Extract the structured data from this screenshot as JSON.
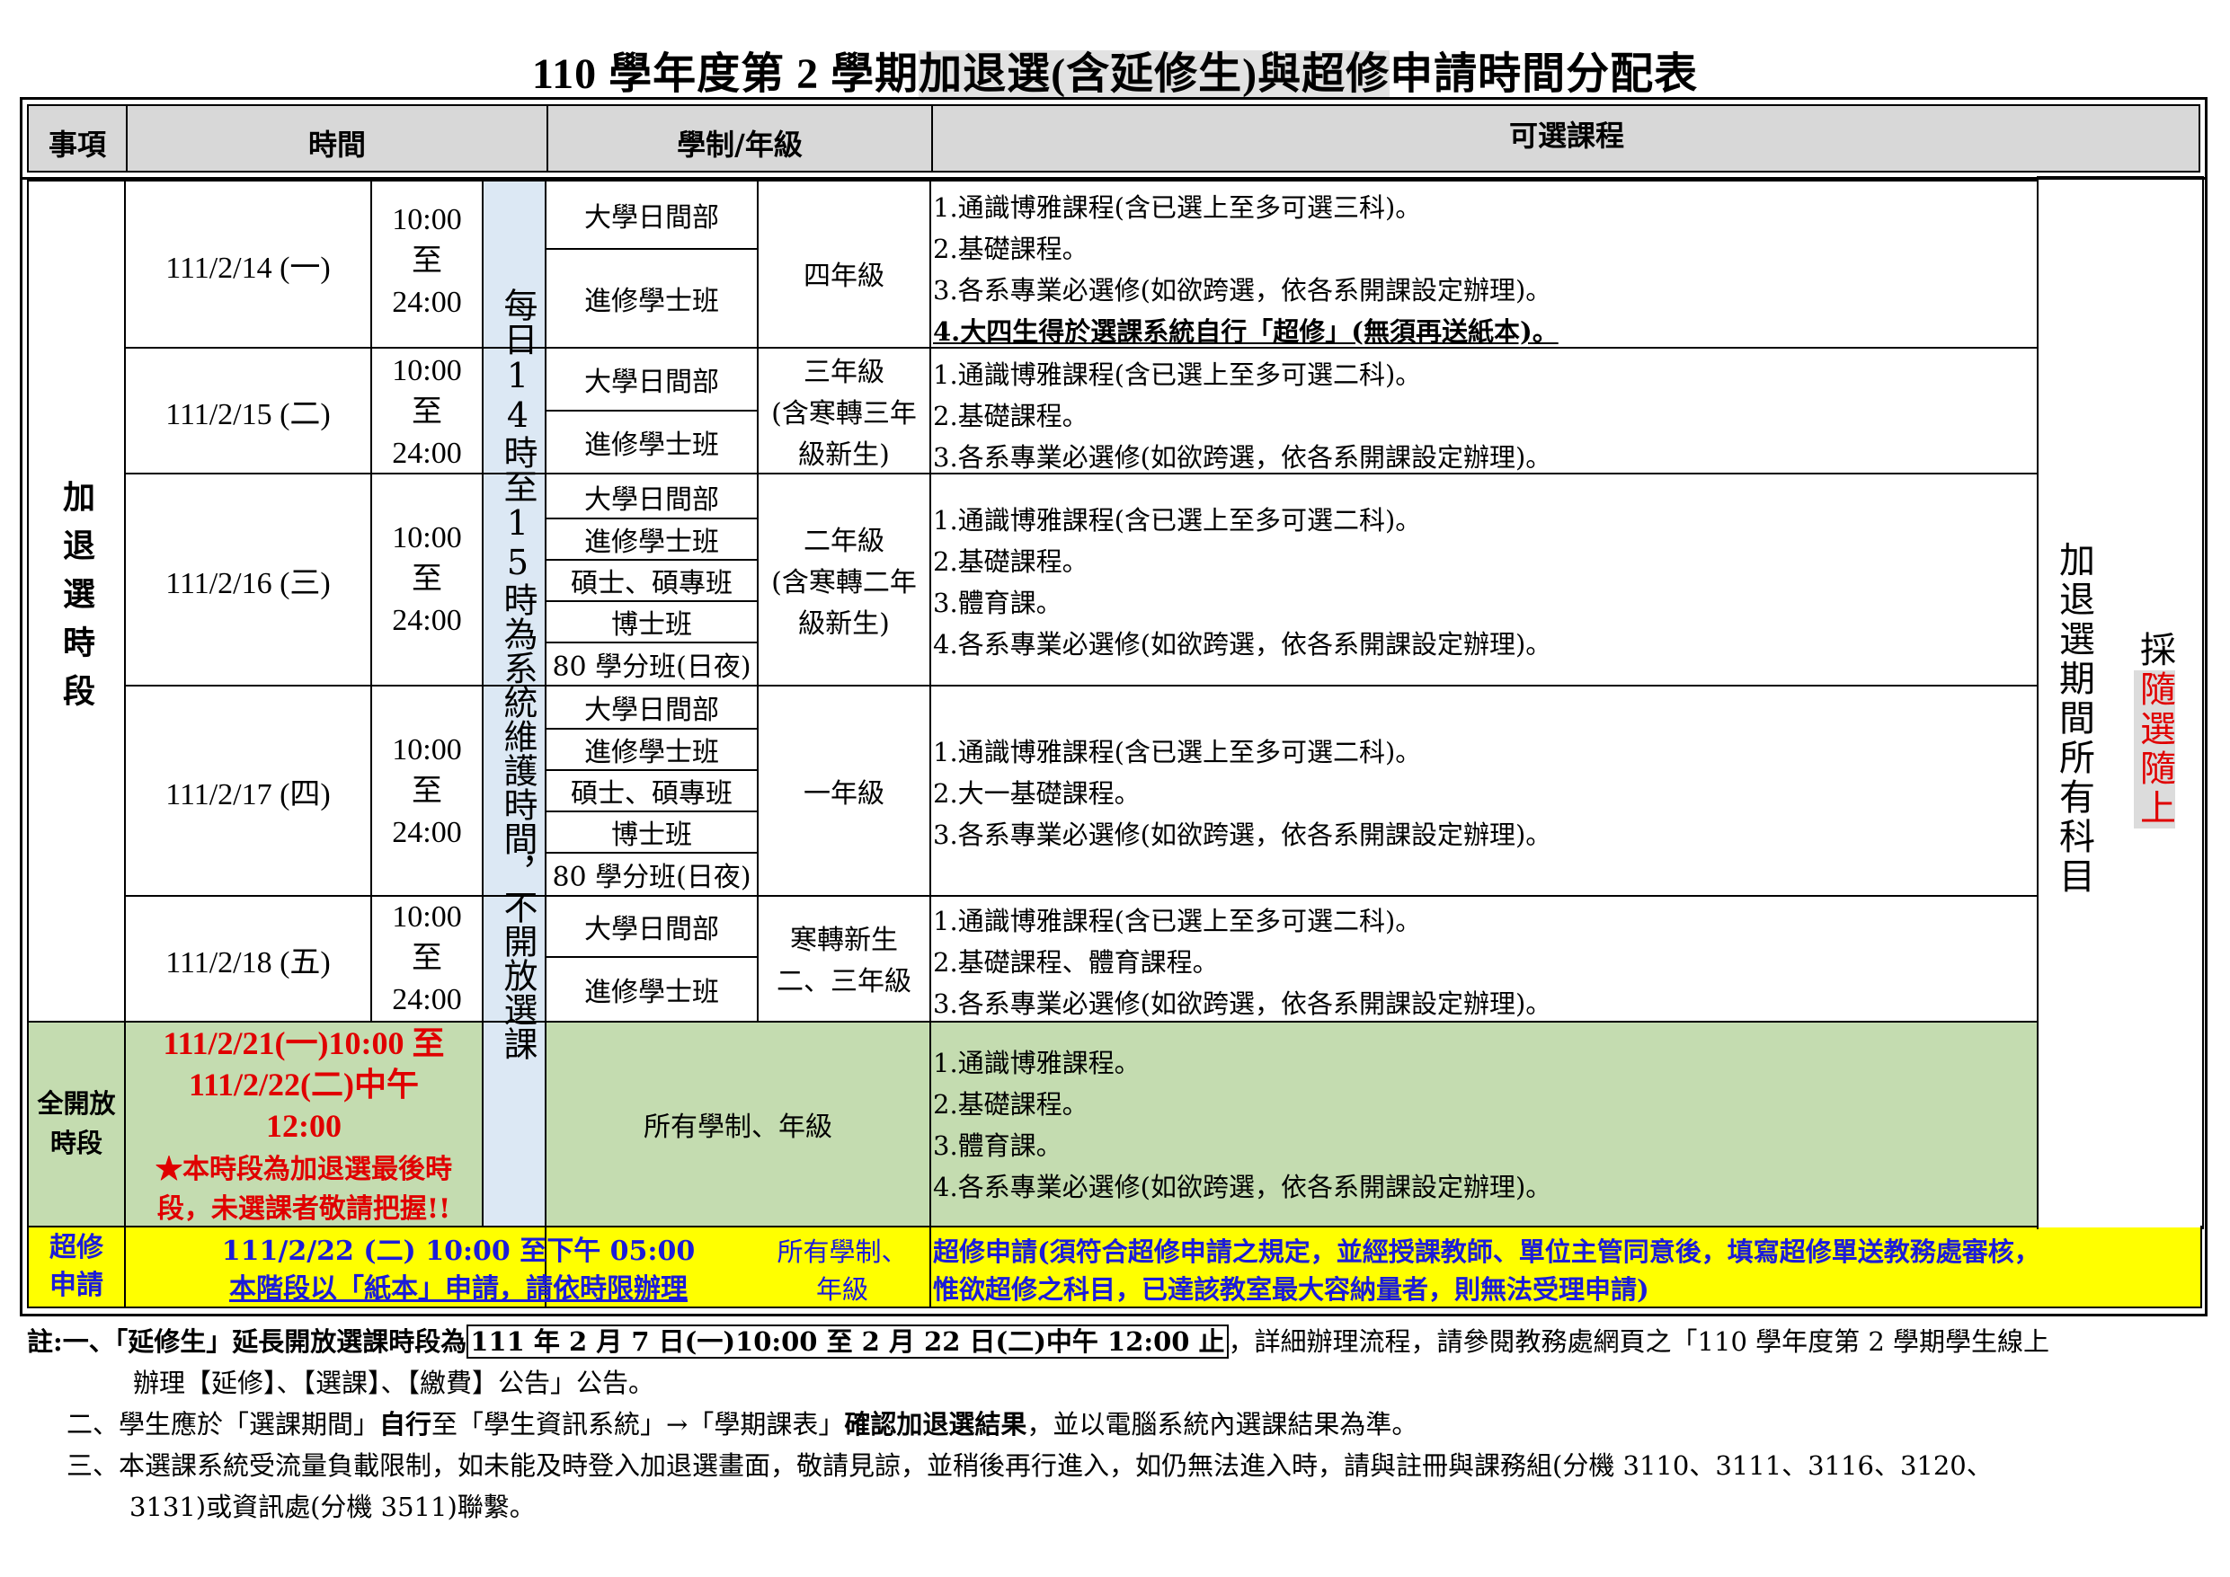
{
  "title": {
    "pre": "110 學年度第 2 學期",
    "hl1": "加退選(含延修生)與",
    "hl2": "超修",
    "post": "申請時間分配表"
  },
  "header": {
    "item": "事項",
    "time": "時間",
    "system": "學制/年級",
    "courses": "可選課程"
  },
  "section_addrop": "加退選時段",
  "maintenance": "每日14時至15時為系統維護時間，不開放選課",
  "right_note": "加退選期間所有科目",
  "right_note2_pre": "採",
  "right_note2_hl": "隨選隨上",
  "days": [
    {
      "date": "111/2/14 (一)",
      "time": [
        "10:00",
        "至",
        "24:00"
      ],
      "systems": [
        "大學日間部",
        "進修學士班"
      ],
      "grade": "四年級",
      "courses": [
        "1.通識博雅課程(含已選上至多可選三科)。",
        "2.基礎課程。",
        "3.各系專業必選修(如欲跨選，依各系開課設定辦理)。",
        "4.大四生得於選課系統自行「超修」(無須再送紙本)。"
      ]
    },
    {
      "date": "111/2/15 (二)",
      "time": [
        "10:00",
        "至",
        "24:00"
      ],
      "systems": [
        "大學日間部",
        "進修學士班"
      ],
      "grade": [
        "三年級",
        "(含寒轉三年",
        "級新生)"
      ],
      "courses": [
        "1.通識博雅課程(含已選上至多可選二科)。",
        "2.基礎課程。",
        "3.各系專業必選修(如欲跨選，依各系開課設定辦理)。"
      ]
    },
    {
      "date": "111/2/16 (三)",
      "time": [
        "10:00",
        "至",
        "24:00"
      ],
      "systems": [
        "大學日間部",
        "進修學士班",
        "碩士、碩專班",
        "博士班",
        "80 學分班(日夜)"
      ],
      "grade": [
        "二年級",
        "(含寒轉二年",
        "級新生)"
      ],
      "courses": [
        "1.通識博雅課程(含已選上至多可選二科)。",
        "2.基礎課程。",
        "3.體育課。",
        "4.各系專業必選修(如欲跨選，依各系開課設定辦理)。"
      ]
    },
    {
      "date": "111/2/17 (四)",
      "time": [
        "10:00",
        "至",
        "24:00"
      ],
      "systems": [
        "大學日間部",
        "進修學士班",
        "碩士、碩專班",
        "博士班",
        "80 學分班(日夜)"
      ],
      "grade": "一年級",
      "courses": [
        "1.通識博雅課程(含已選上至多可選二科)。",
        "2.大一基礎課程。",
        "3.各系專業必選修(如欲跨選，依各系開課設定辦理)。"
      ]
    },
    {
      "date": "111/2/18 (五)",
      "time": [
        "10:00",
        "至",
        "24:00"
      ],
      "systems": [
        "大學日間部",
        "進修學士班"
      ],
      "grade": [
        "寒轉新生",
        "二、三年級"
      ],
      "courses": [
        "1.通識博雅課程(含已選上至多可選二科)。",
        "2.基礎課程、體育課程。",
        "3.各系專業必選修(如欲跨選，依各系開課設定辦理)。"
      ]
    }
  ],
  "open_period": {
    "label": "全開放時段",
    "time_lines": [
      "111/2/21(一)10:00 至",
      "111/2/22(二)中午",
      "12:00"
    ],
    "warning": [
      "★本時段為加退選最後時",
      "段，未選課者敬請把握!!"
    ],
    "system": "所有學制、年級",
    "courses": [
      "1.通識博雅課程。",
      "2.基礎課程。",
      "3.體育課。",
      "4.各系專業必選修(如欲跨選，依各系開課設定辦理)。"
    ]
  },
  "overload": {
    "label": [
      "超修",
      "申請"
    ],
    "time": "111/2/22 (二) 10:00 至下午 05:00",
    "time_note": "本階段以「紙本」申請，請依時限辦理",
    "system": [
      "所有學制、",
      "年級"
    ],
    "desc_bold": "超修申請",
    "desc_1": "(須符合超修申請之規定，並經授課教師、單位主管同意後，填寫超修單送教務處審核，",
    "desc_2": "惟欲超修之科目，已達該教室最大容納量者，則無法受理申請)"
  },
  "notes": {
    "n1_label": "註:一、",
    "n1_a": "「延修生」延長開放選課時段為",
    "n1_box": "111 年 2 月 7 日(一)10:00 至 2 月 22 日(二)中午 12:00 止",
    "n1_b": "，詳細辦理流程，請參閱教務處網頁之「110 學年度第 2 學期學生線上",
    "n1_c": "辦理【延修】、【選課】、【繳費】公告」公告。",
    "n2_a": "二、學生應於「選課期間」",
    "n2_b1": "自行",
    "n2_b": "至「學生資訊系統」→「學期課表」",
    "n2_c1": "確認加退選結果",
    "n2_c": "，並以電腦系統內選課結果為準。",
    "n3_a": "三、本選課系統受流量負載限制，如未能及時登入加退選畫面，敬請見諒，並稍後再行進入，如仍無法進入時，請與註冊與課務組(分機 3110、3111、3116、3120、",
    "n3_b": "3131)或資訊處(分機 3511)聯繫。"
  }
}
